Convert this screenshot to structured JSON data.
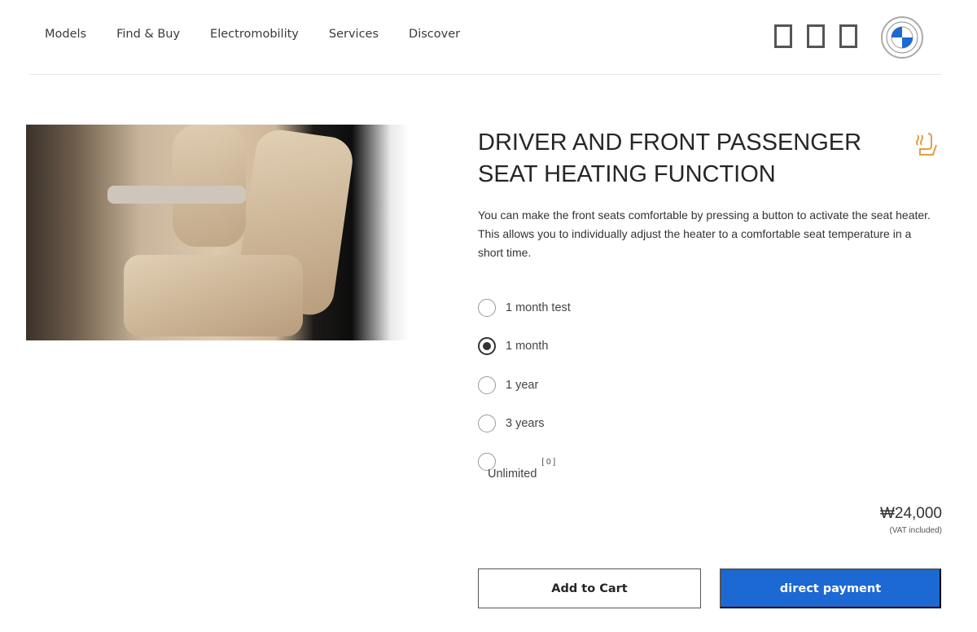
{
  "nav": {
    "items": [
      "Models",
      "Find & Buy",
      "Electromobility",
      "Services",
      "Discover"
    ]
  },
  "header_icons": [
    "placeholder-box-icon",
    "placeholder-box-icon",
    "placeholder-box-icon"
  ],
  "brand": {
    "logo": "BMW",
    "colors": {
      "blue": "#1c69d4"
    }
  },
  "product": {
    "title": "DRIVER AND FRONT PASSENGER SEAT HEATING FUNCTION",
    "icon": "heated-seat-icon",
    "description": "You can make the front seats comfortable by pressing a button to activate the seat heater. This allows you to individually adjust the heater to a comfortable seat temperature in a short time.",
    "options": [
      {
        "label": "1 month test",
        "selected": false
      },
      {
        "label": "1 month",
        "selected": true
      },
      {
        "label": "1 year",
        "selected": false
      },
      {
        "label": "3 years",
        "selected": false
      },
      {
        "label": "Unlimited",
        "selected": false,
        "note": "[ 0 ]"
      }
    ],
    "price": "₩24,000",
    "vat": "(VAT included)"
  },
  "actions": {
    "add_to_cart": "Add to Cart",
    "direct_payment": "direct payment"
  }
}
